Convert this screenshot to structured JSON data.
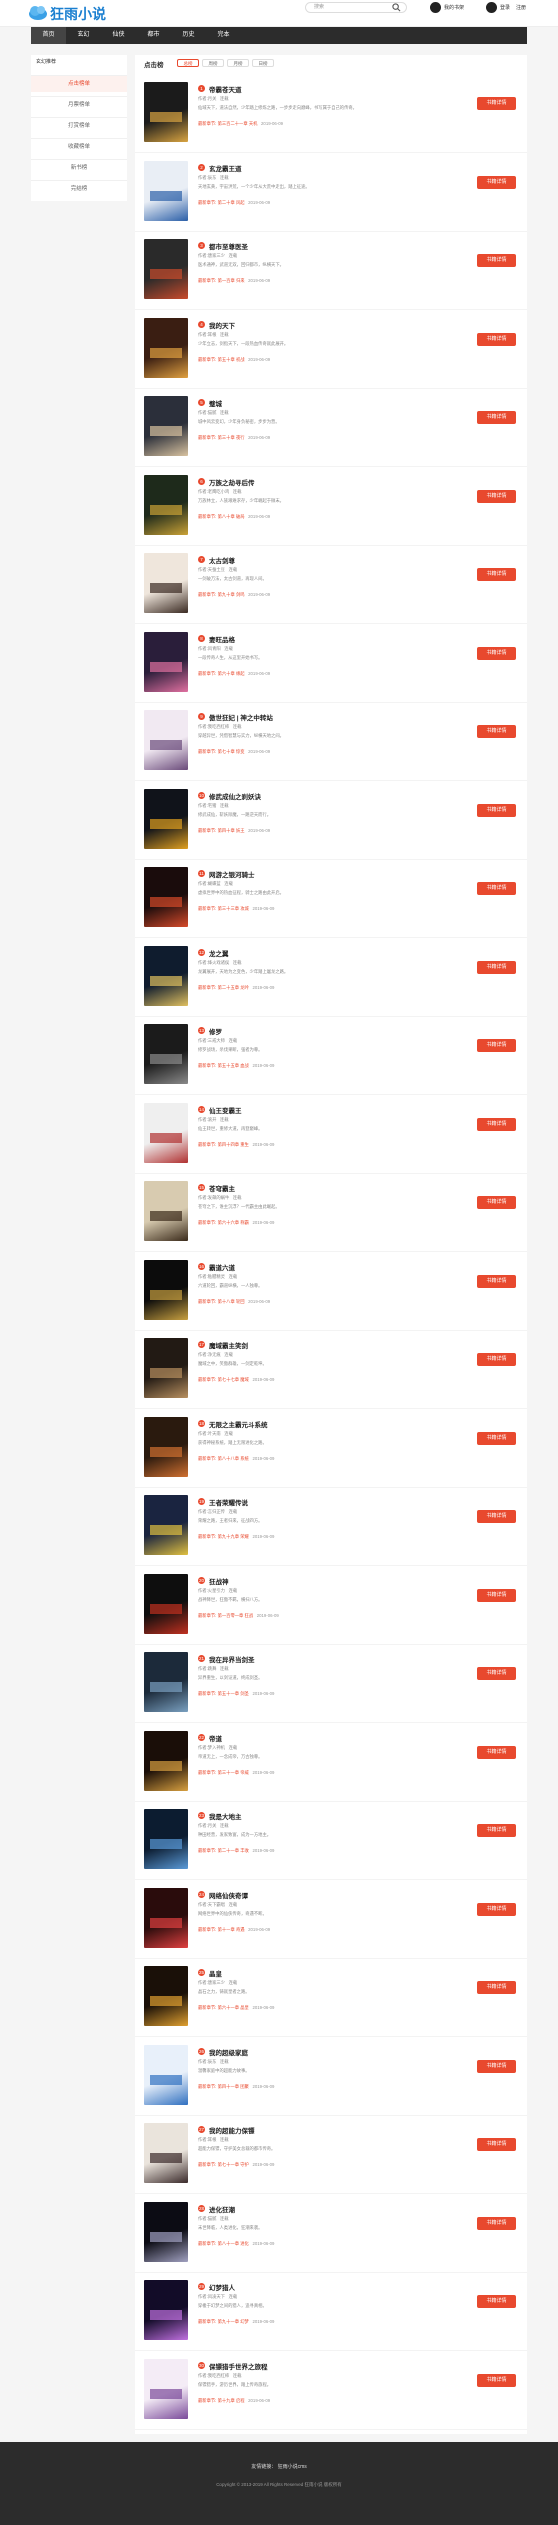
{
  "header": {
    "logo_text": "狂雨小说",
    "search_placeholder": "搜索",
    "reading_history": "我的书架",
    "login": "登录",
    "register": "注册"
  },
  "nav": {
    "items": [
      "首页",
      "玄幻",
      "仙侠",
      "都市",
      "历史",
      "完本"
    ]
  },
  "sidebar": {
    "title": "玄幻推荐",
    "items": [
      "点击榜单",
      "月票榜单",
      "打赏榜单",
      "收藏榜单",
      "新书榜",
      "完结榜"
    ]
  },
  "ranking": {
    "title": "点击榜",
    "tabs": [
      "总榜",
      "周榜",
      "月榜",
      "日榜"
    ]
  },
  "read_label": "书籍详情",
  "books": [
    {
      "rank": "1",
      "title": "帝霸苍天道",
      "author": "作者:月关",
      "status": "连载",
      "desc": "仙域天下，道法自然，少年踏上修炼之路，一步步走向巅峰，书写属于自己的传奇。",
      "latest": "最新章节: 第三百二十一章 天机",
      "date": "2019-06-09"
    },
    {
      "rank": "2",
      "title": "玄龙霸王道",
      "author": "作者:辰东",
      "status": "连载",
      "desc": "天地玄黄，宇宙洪荒，一个少年从大荒中走出，踏上征途。",
      "latest": "最新章节: 第二十章 风起",
      "date": "2019-06-09"
    },
    {
      "rank": "3",
      "title": "都市至尊医圣",
      "author": "作者:唐家三少",
      "status": "连载",
      "desc": "医术通神，武道无双，回归都市，纵横天下。",
      "latest": "最新章节: 第一百章 归来",
      "date": "2019-06-09"
    },
    {
      "rank": "4",
      "title": "我的天下",
      "author": "作者:耳根",
      "status": "连载",
      "desc": "少年立志，剑指天下，一段热血传奇就此展开。",
      "latest": "最新章节: 第五十章 初战",
      "date": "2019-06-09"
    },
    {
      "rank": "5",
      "title": "璧城",
      "author": "作者:猫腻",
      "status": "连载",
      "desc": "城中风云变幻，少年身负秘密，步步为营。",
      "latest": "最新章节: 第三十章 夜行",
      "date": "2019-06-09"
    },
    {
      "rank": "6",
      "title": "万族之劫寻后传",
      "author": "作者:老鹰吃小鸡",
      "status": "连载",
      "desc": "万族林立，人族艰难求存，少年崛起于微末。",
      "latest": "最新章节: 第八十章 破局",
      "date": "2019-06-09"
    },
    {
      "rank": "7",
      "title": "太古剑尊",
      "author": "作者:天蚕土豆",
      "status": "连载",
      "desc": "一剑破万法，太古剑道，再现人间。",
      "latest": "最新章节: 第九十章 剑鸣",
      "date": "2019-06-09"
    },
    {
      "rank": "8",
      "title": "妻旺品格",
      "author": "作者:风青阳",
      "status": "连载",
      "desc": "一段传奇人生，从这里开始书写。",
      "latest": "最新章节: 第六十章 缘起",
      "date": "2019-06-09"
    },
    {
      "rank": "9",
      "title": "傲世狂妃 | 神之中转站",
      "author": "作者:我吃西红柿",
      "status": "连载",
      "desc": "穿越异世，凭借智慧与实力，纵横天地之间。",
      "latest": "最新章节: 第七十章 惊变",
      "date": "2019-06-09"
    },
    {
      "rank": "10",
      "title": "修武成仙之刹妖诀",
      "author": "作者:宅猪",
      "status": "连载",
      "desc": "修武成仙，斩妖除魔，一路逆天而行。",
      "latest": "最新章节: 第四十章 妖王",
      "date": "2019-06-09"
    },
    {
      "rank": "11",
      "title": "网游之银河骑士",
      "author": "作者:蝴蝶蓝",
      "status": "连载",
      "desc": "虚拟世界中的热血征程，骑士之路由此开启。",
      "latest": "最新章节: 第三十三章 攻城",
      "date": "2019-06-09"
    },
    {
      "rank": "12",
      "title": "龙之翼",
      "author": "作者:烽火戏诸侯",
      "status": "连载",
      "desc": "龙翼展开，天地为之变色，少年踏上屠龙之路。",
      "latest": "最新章节: 第二十五章 龙吟",
      "date": "2019-06-09"
    },
    {
      "rank": "13",
      "title": "修罗",
      "author": "作者:三戒大师",
      "status": "连载",
      "desc": "修罗战场，杀伐果断，强者为尊。",
      "latest": "最新章节: 第五十五章 血战",
      "date": "2019-06-09"
    },
    {
      "rank": "14",
      "title": "仙王变霸王",
      "author": "作者:滚开",
      "status": "连载",
      "desc": "仙王转世，重修大道，再登巅峰。",
      "latest": "最新章节: 第四十四章 重生",
      "date": "2019-06-09"
    },
    {
      "rank": "15",
      "title": "苍穹霸主",
      "author": "作者:发飙的蜗牛",
      "status": "连载",
      "desc": "苍穹之下，谁主沉浮？一代霸主由此崛起。",
      "latest": "最新章节: 第六十六章 称霸",
      "date": "2019-06-09"
    },
    {
      "rank": "16",
      "title": "霸道六道",
      "author": "作者:骷髅精灵",
      "status": "连载",
      "desc": "六道轮回，霸道纵横，一人独尊。",
      "latest": "最新章节: 第十八章 轮回",
      "date": "2019-06-09"
    },
    {
      "rank": "17",
      "title": "魔域霸主笑剑",
      "author": "作者:净无痕",
      "status": "连载",
      "desc": "魔域之中，笑傲群雄，一剑定乾坤。",
      "latest": "最新章节: 第七十七章 魔域",
      "date": "2019-06-09"
    },
    {
      "rank": "18",
      "title": "无限之主霸元斗系统",
      "author": "作者:叶天南",
      "status": "连载",
      "desc": "获得神秘系统，踏上无限进化之路。",
      "latest": "最新章节: 第八十八章 系统",
      "date": "2019-06-09"
    },
    {
      "rank": "19",
      "title": "王者荣耀传说",
      "author": "作者:言归正传",
      "status": "连载",
      "desc": "荣耀之路，王者归来，征战四方。",
      "latest": "最新章节: 第九十九章 荣耀",
      "date": "2019-06-09"
    },
    {
      "rank": "20",
      "title": "狂战神",
      "author": "作者:火星引力",
      "status": "连载",
      "desc": "战神降世，狂傲不羁，横扫八方。",
      "latest": "最新章节: 第一百零一章 狂战",
      "date": "2019-06-09"
    },
    {
      "rank": "21",
      "title": "我在异界当剑圣",
      "author": "作者:跳舞",
      "status": "连载",
      "desc": "异界重生，以剑证道，终成剑圣。",
      "latest": "最新章节: 第五十一章 剑圣",
      "date": "2019-06-09"
    },
    {
      "rank": "22",
      "title": "帝道",
      "author": "作者:梦入神机",
      "status": "连载",
      "desc": "帝道无上，一念成帝，万古独尊。",
      "latest": "最新章节: 第三十一章 帝威",
      "date": "2019-06-09"
    },
    {
      "rank": "23",
      "title": "我是大地主",
      "author": "作者:月关",
      "status": "连载",
      "desc": "种田经营，发家致富，成为一方地主。",
      "latest": "最新章节: 第二十一章 丰收",
      "date": "2019-06-09"
    },
    {
      "rank": "24",
      "title": "网络仙侠奇谭",
      "author": "作者:天下霸唱",
      "status": "连载",
      "desc": "网络世界中的仙侠传奇，奇遇不断。",
      "latest": "最新章节: 第十一章 奇遇",
      "date": "2019-06-09"
    },
    {
      "rank": "25",
      "title": "晶皇",
      "author": "作者:唐家三少",
      "status": "连载",
      "desc": "晶石之力，铸就皇者之路。",
      "latest": "最新章节: 第六十一章 晶皇",
      "date": "2019-06-09"
    },
    {
      "rank": "26",
      "title": "我的超级家庭",
      "author": "作者:辰东",
      "status": "连载",
      "desc": "温馨家庭中的超能力故事。",
      "latest": "最新章节: 第四十一章 团聚",
      "date": "2019-06-09"
    },
    {
      "rank": "27",
      "title": "我的超能力保镖",
      "author": "作者:耳根",
      "status": "连载",
      "desc": "超能力保镖，守护美女总裁的都市传奇。",
      "latest": "最新章节: 第七十一章 守护",
      "date": "2019-06-09"
    },
    {
      "rank": "28",
      "title": "进化狂潮",
      "author": "作者:猫腻",
      "status": "连载",
      "desc": "末世降临，人类进化，狂潮来袭。",
      "latest": "最新章节: 第八十一章 进化",
      "date": "2019-06-09"
    },
    {
      "rank": "29",
      "title": "幻梦猎人",
      "author": "作者:风凌天下",
      "status": "连载",
      "desc": "穿梭于幻梦之间的猎人，追寻真相。",
      "latest": "最新章节: 第九十一章 幻梦",
      "date": "2019-06-09"
    },
    {
      "rank": "30",
      "title": "保镖猎手世界之旅程",
      "author": "作者:我吃西红柿",
      "status": "连载",
      "desc": "保镖猎手，游历世界，踏上传奇旅程。",
      "latest": "最新章节: 第十九章 启程",
      "date": "2019-06-09"
    }
  ],
  "footer": {
    "line1": "友情链接：    狂雨小说cms",
    "line2": "Copyright © 2013-2019 All Rights Reserved 狂雨小说 版权所有"
  },
  "colors": {
    "accent": "#e8492e",
    "nav_bg": "#2c2c2c",
    "brand": "#1a7fd0"
  }
}
